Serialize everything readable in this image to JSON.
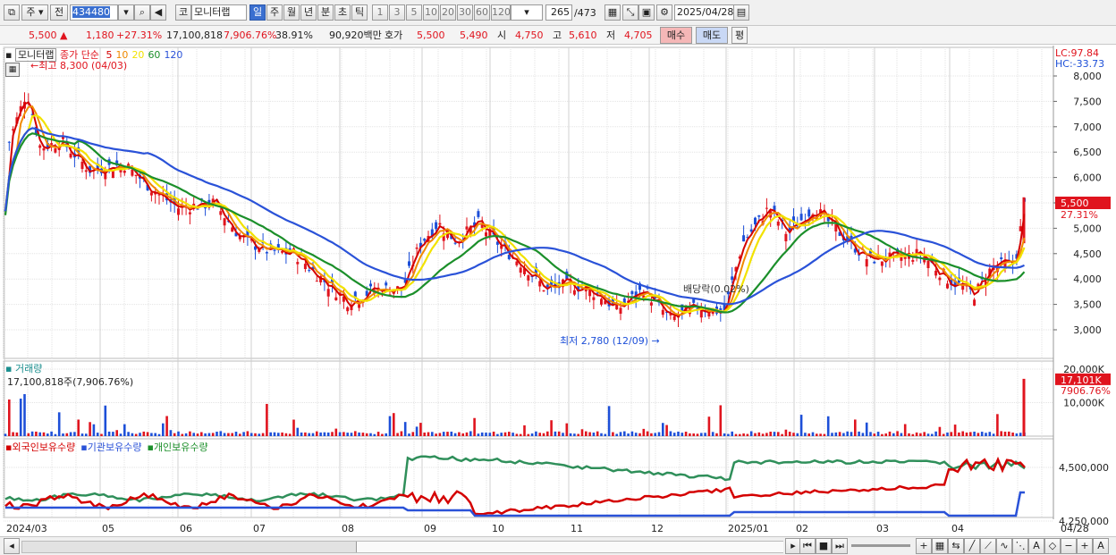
{
  "toolbar": {
    "period_type": "주",
    "market": "전",
    "code": "434480",
    "market_tag": "코",
    "name": "모니터랩",
    "periods": [
      "일",
      "주",
      "월",
      "년",
      "분",
      "초",
      "틱"
    ],
    "active_period": "일",
    "intervals": [
      "1",
      "3",
      "5",
      "10",
      "20",
      "30",
      "60",
      "120"
    ],
    "count_value": "265",
    "count_total": "/473",
    "date": "2025/04/28"
  },
  "quote": {
    "price": "5,500",
    "change": "1,180",
    "change_pct": "+27.31%",
    "volume": "17,100,818",
    "vol_pct": "7,906.76%",
    "turnover": "38.91%",
    "amount": "90,920백만",
    "hoga_label": "호가",
    "ask": "5,500",
    "bid": "5,490",
    "open_label": "시",
    "open": "4,750",
    "high_label": "고",
    "high": "5,610",
    "low_label": "저",
    "low": "4,705",
    "buy_label": "매수",
    "sell_label": "매도",
    "eval_label": "평"
  },
  "legend": {
    "name": "모니터랩",
    "ma_label": "종가 단순",
    "ma_periods": [
      "5",
      "10",
      "20",
      "60",
      "120"
    ],
    "ma_colors": [
      "#d40000",
      "#f08a00",
      "#f2e200",
      "#1b8f2a",
      "#2a52d8"
    ],
    "high_marker": "최고 8,300 (04/03)",
    "low_marker": "최저 2,780 (12/09)",
    "dividend": "배당락(0.02%)",
    "lc": "LC:97.84",
    "hc": "HC:-33.73",
    "volume_title": "거래량",
    "volume_value": "17,100,818주(7,906.76%)",
    "holdings": [
      "외국인보유수량",
      "기관보유수량",
      "개인보유수량"
    ],
    "holding_colors": [
      "#d40000",
      "#2a52d8",
      "#1b8f2a"
    ]
  },
  "axes": {
    "price_ticks": [
      "8,000",
      "7,500",
      "7,000",
      "6,500",
      "6,000",
      "5,500",
      "5,000",
      "4,500",
      "4,000",
      "3,500",
      "3,000"
    ],
    "price_tag": "5,500",
    "pct_tag": "27.31%",
    "volume_ticks": [
      "20,000K",
      "10,000K"
    ],
    "volume_tag": "17,101K",
    "volume_pct_tag": "7906.76%",
    "holding_ticks": [
      "4,500,000",
      "4,250,000"
    ],
    "month_labels": [
      "2024/03",
      "05",
      "06",
      "07",
      "08",
      "09",
      "10",
      "11",
      "12",
      "2025/01",
      "02",
      "03",
      "04"
    ],
    "right_date": "04/28"
  }
}
